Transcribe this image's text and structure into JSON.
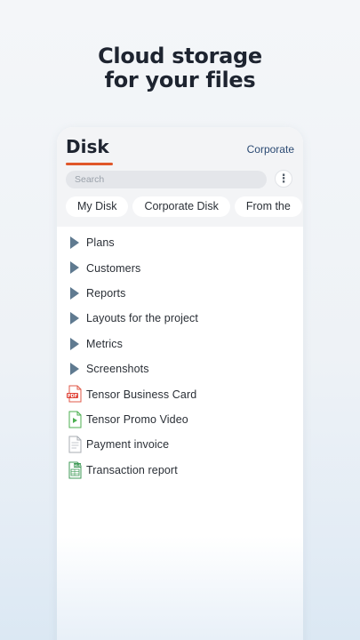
{
  "headline": {
    "line1": "Cloud storage",
    "line2": "for your files"
  },
  "header": {
    "title": "Disk",
    "corporate_link": "Corporate",
    "search_placeholder": "Search",
    "accent_color": "#e0572a"
  },
  "tabs": [
    {
      "label": "My Disk"
    },
    {
      "label": "Corporate Disk"
    },
    {
      "label": "From the"
    }
  ],
  "files": [
    {
      "label": "Plans",
      "icon": "folder-arrow-icon"
    },
    {
      "label": "Customers",
      "icon": "folder-arrow-icon"
    },
    {
      "label": "Reports",
      "icon": "folder-arrow-icon"
    },
    {
      "label": "Layouts for the project",
      "icon": "folder-arrow-icon"
    },
    {
      "label": "Metrics",
      "icon": "folder-arrow-icon"
    },
    {
      "label": "Screenshots",
      "icon": "folder-arrow-icon"
    },
    {
      "label": "Tensor Business Card",
      "icon": "pdf-file-icon",
      "badge": "PDF"
    },
    {
      "label": "Tensor Promo Video",
      "icon": "video-file-icon"
    },
    {
      "label": "Payment invoice",
      "icon": "document-file-icon"
    },
    {
      "label": "Transaction report",
      "icon": "spreadsheet-file-icon",
      "badge": "XLS"
    }
  ]
}
